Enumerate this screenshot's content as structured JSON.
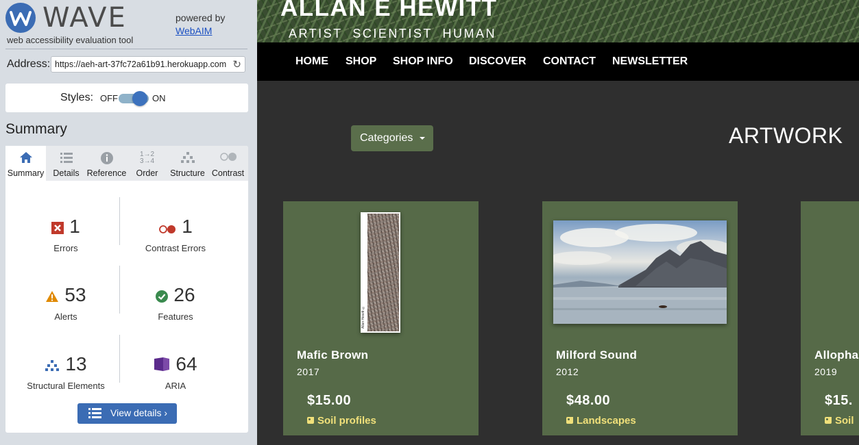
{
  "wave": {
    "name": "WAVE",
    "tagline": "web accessibility evaluation tool",
    "powered_by": "powered by",
    "powered_link": "WebAIM",
    "address_label": "Address:",
    "address_value": "https://aeh-art-37fc72a61b91.herokuapp.com",
    "styles_label": "Styles:",
    "styles_off": "OFF",
    "styles_on": "ON",
    "styles_state": "on",
    "summary_heading": "Summary",
    "tabs": [
      {
        "label": "Summary",
        "icon": "home-icon",
        "active": true
      },
      {
        "label": "Details",
        "icon": "list-icon",
        "active": false
      },
      {
        "label": "Reference",
        "icon": "info-icon",
        "active": false
      },
      {
        "label": "Order",
        "icon": "order-icon",
        "active": false
      },
      {
        "label": "Structure",
        "icon": "structure-icon",
        "active": false
      },
      {
        "label": "Contrast",
        "icon": "contrast-icon",
        "active": false
      }
    ],
    "stats": {
      "errors": {
        "count": "1",
        "label": "Errors",
        "icon": "error-icon",
        "color": "#c0392b"
      },
      "contrast_errors": {
        "count": "1",
        "label": "Contrast Errors",
        "icon": "contrast-error-icon",
        "color": "#c0392b"
      },
      "alerts": {
        "count": "53",
        "label": "Alerts",
        "icon": "alert-icon",
        "color": "#e08a00"
      },
      "features": {
        "count": "26",
        "label": "Features",
        "icon": "feature-icon",
        "color": "#3a8a4e"
      },
      "structural": {
        "count": "13",
        "label": "Structural Elements",
        "icon": "structure-icon",
        "color": "#3b6cb4"
      },
      "aria": {
        "count": "64",
        "label": "ARIA",
        "icon": "aria-icon",
        "color": "#5b2b8c"
      }
    },
    "view_details": "View details ›"
  },
  "site": {
    "title": "ALLAN E HEWITT",
    "subtitle": "ARTIST  SCIENTIST  HUMAN",
    "nav": [
      "HOME",
      "SHOP",
      "SHOP INFO",
      "DISCOVER",
      "CONTACT",
      "NEWSLETTER"
    ],
    "categories_button": "Categories",
    "heading": "ARTWORK",
    "artworks": [
      {
        "title": "Mafic Brown",
        "year": "2017",
        "price": "$15.00",
        "category": "Soil profiles"
      },
      {
        "title": "Milford Sound",
        "year": "2012",
        "price": "$48.00",
        "category": "Landscapes"
      },
      {
        "title": "Allopha",
        "year": "2019",
        "price": "$15.",
        "category": "Soil"
      }
    ],
    "image_caption": "Allan Hewitt ©"
  }
}
